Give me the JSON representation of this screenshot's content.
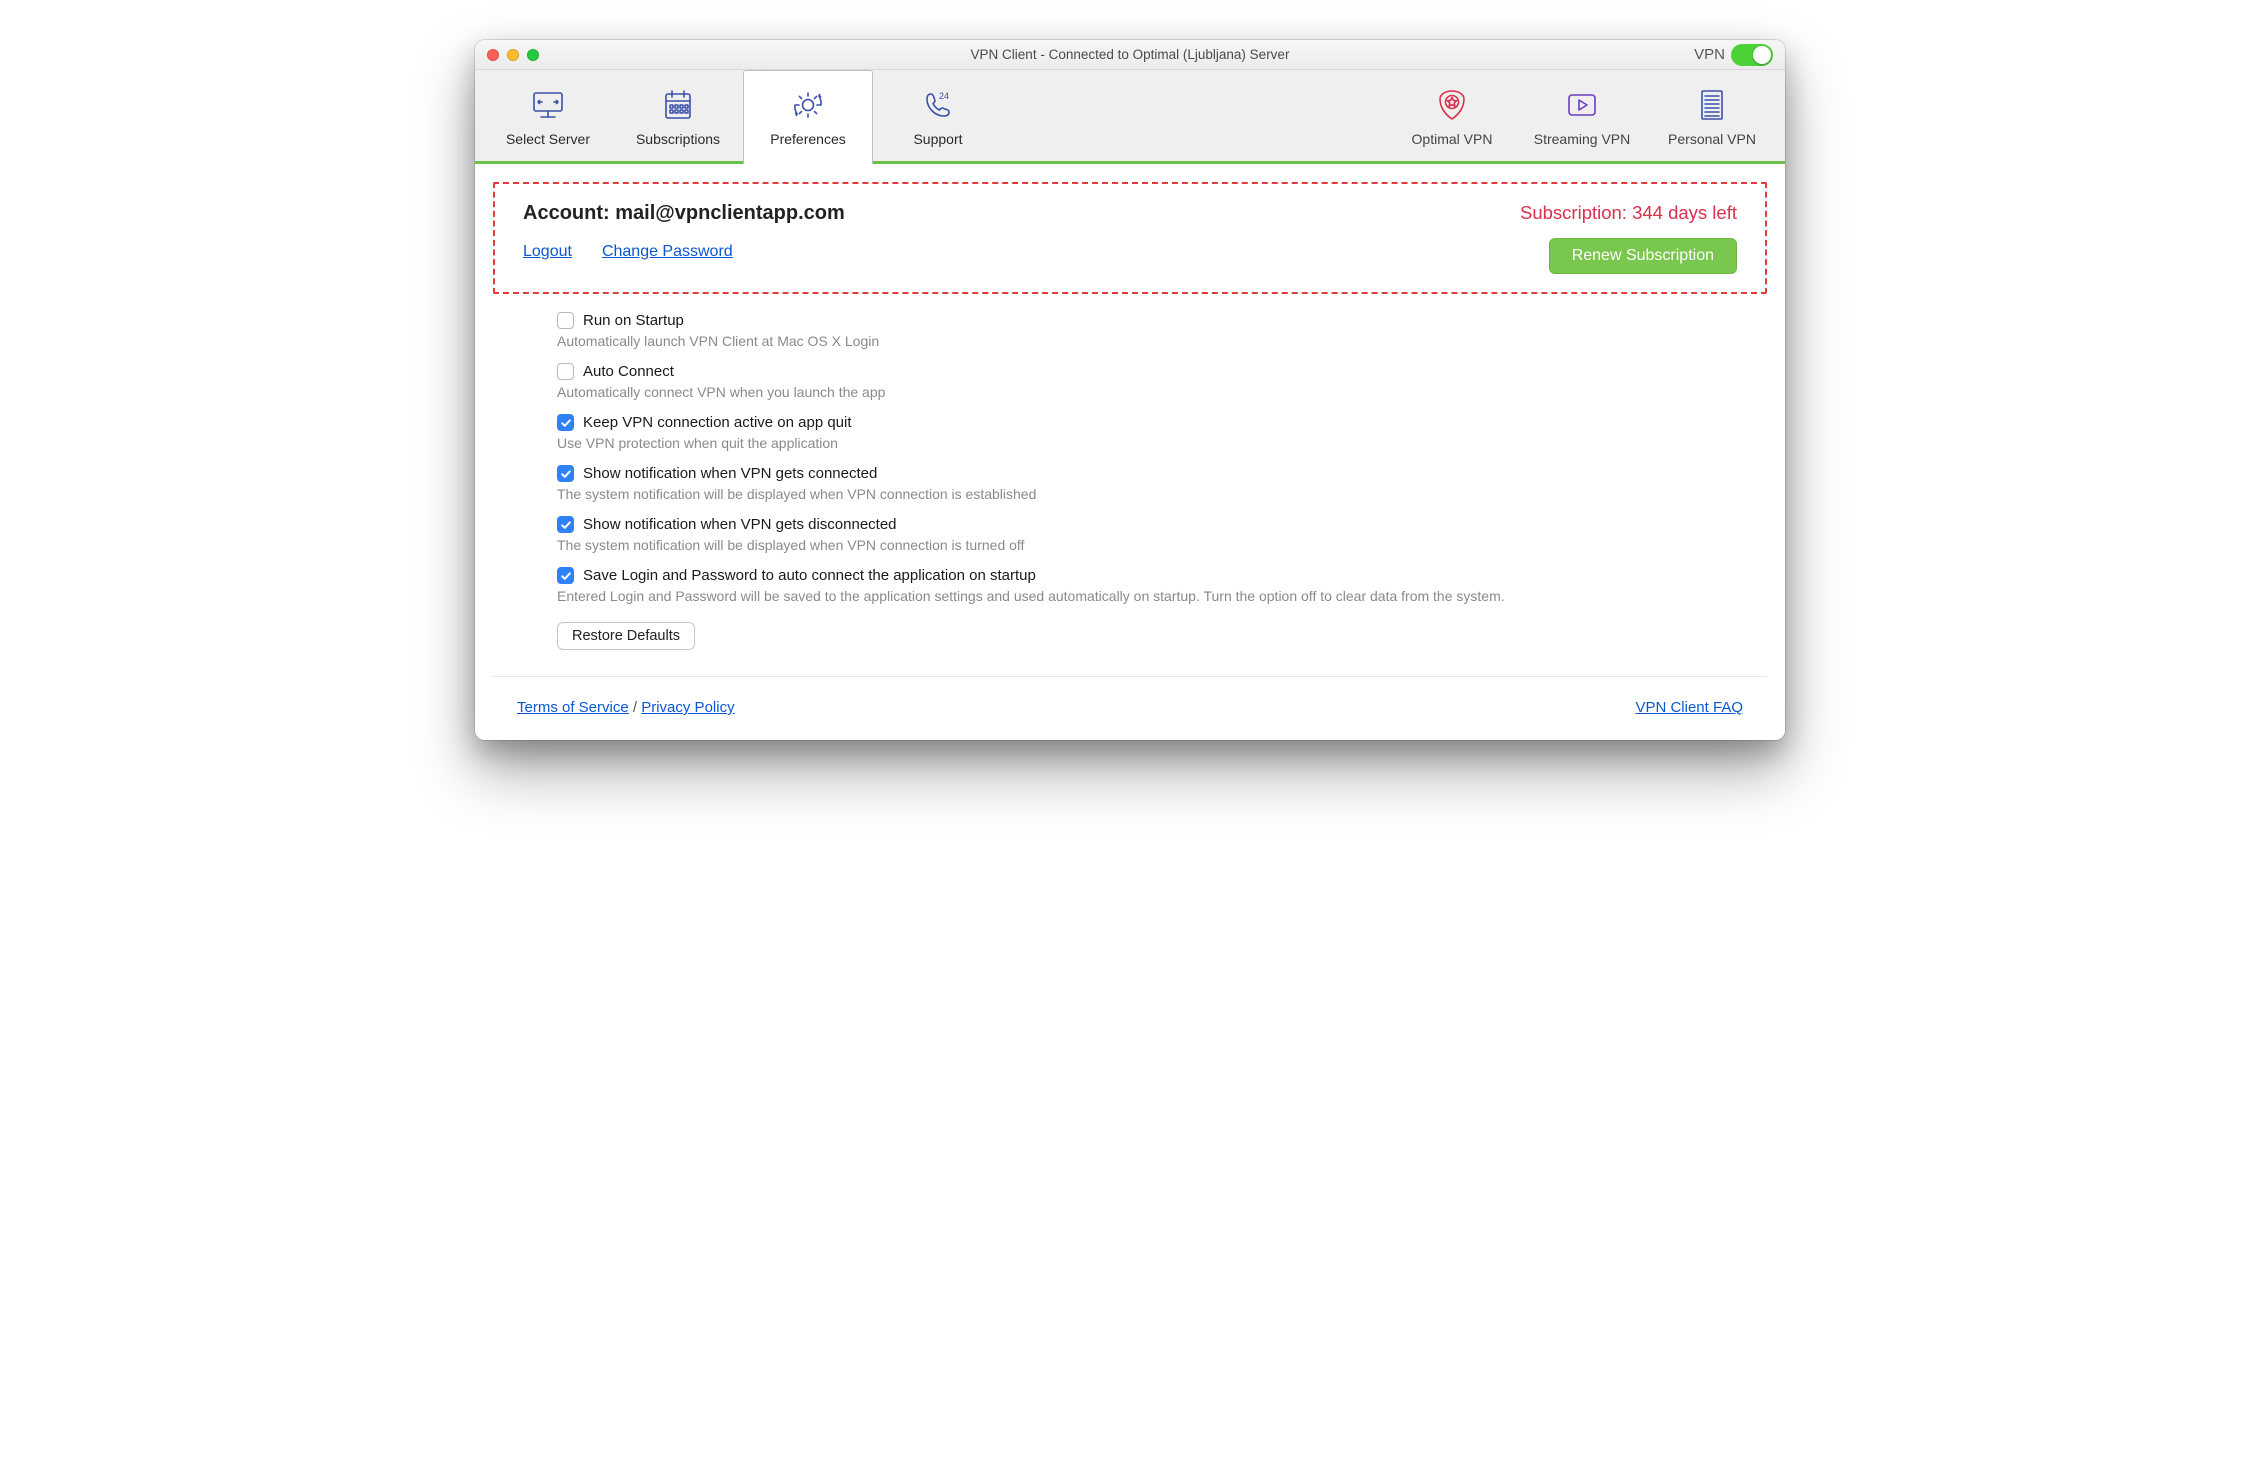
{
  "window": {
    "title": "VPN Client - Connected to Optimal (Ljubljana) Server",
    "vpn_toggle_label": "VPN",
    "vpn_toggle_on": true
  },
  "tabs": {
    "left": [
      {
        "key": "select-server",
        "label": "Select Server",
        "icon": "monitor-arrows-icon"
      },
      {
        "key": "subscriptions",
        "label": "Subscriptions",
        "icon": "calendar-icon"
      },
      {
        "key": "preferences",
        "label": "Preferences",
        "icon": "gear-rotate-icon",
        "active": true
      },
      {
        "key": "support",
        "label": "Support",
        "icon": "phone-24-icon"
      }
    ],
    "right": [
      {
        "key": "optimal-vpn",
        "label": "Optimal VPN",
        "icon": "badge-star-icon",
        "color": "#d9304c"
      },
      {
        "key": "streaming-vpn",
        "label": "Streaming VPN",
        "icon": "play-square-icon",
        "color": "#6a3cc2"
      },
      {
        "key": "personal-vpn",
        "label": "Personal VPN",
        "icon": "server-rack-icon",
        "color": "#3a4fab"
      }
    ]
  },
  "account": {
    "label_prefix": "Account:",
    "email": "mail@vpnclientapp.com",
    "logout": "Logout",
    "change_password": "Change Password",
    "subscription_text": "Subscription: 344 days left",
    "renew_button": "Renew Subscription"
  },
  "prefs": [
    {
      "key": "run-startup",
      "checked": false,
      "label": "Run on Startup",
      "desc": "Automatically launch VPN Client at Mac OS X Login"
    },
    {
      "key": "auto-connect",
      "checked": false,
      "label": "Auto Connect",
      "desc": "Automatically connect VPN when you launch the app"
    },
    {
      "key": "keep-active",
      "checked": true,
      "label": "Keep VPN connection active on app quit",
      "desc": "Use VPN protection when quit the application"
    },
    {
      "key": "notify-conn",
      "checked": true,
      "label": "Show notification when VPN gets connected",
      "desc": "The system notification will be displayed when VPN connection is established"
    },
    {
      "key": "notify-disc",
      "checked": true,
      "label": "Show notification when VPN gets disconnected",
      "desc": "The system notification will be displayed when VPN connection is turned off"
    },
    {
      "key": "save-login",
      "checked": true,
      "label": "Save Login and Password to auto connect the application on startup",
      "desc": "Entered Login and Password will be saved to the application settings and used automatically on startup. Turn the option off to clear data from the system."
    }
  ],
  "restore_button": "Restore Defaults",
  "footer": {
    "terms": "Terms of Service",
    "privacy": "Privacy Policy",
    "separator": "/",
    "faq": "VPN Client FAQ"
  },
  "icons": {
    "monitor-arrows-icon": "monitor",
    "calendar-icon": "calendar",
    "gear-rotate-icon": "gear",
    "phone-24-icon": "phone24",
    "badge-star-icon": "badgestar",
    "play-square-icon": "playsq",
    "server-rack-icon": "serverrack"
  },
  "colors": {
    "toolbar_icon": "#3a4fab",
    "accent_green": "#6dc24b",
    "link_blue": "#0b57d0",
    "danger_red": "#d9304c"
  }
}
